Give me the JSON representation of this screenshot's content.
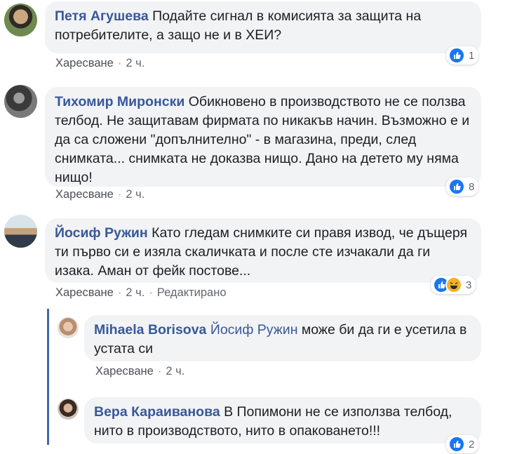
{
  "comments": [
    {
      "author": "Петя Агушева",
      "text": "Подайте сигнал в комисията за защита на",
      "text2": "потребителите, а защо не и в ХЕИ?",
      "like_label": "Харесване",
      "time": "2 ч.",
      "reaction_count": "1"
    },
    {
      "author": "Тихомир Миронски",
      "text": "Обикновено в производството не се ползва",
      "text2": "телбод. Не защитавам фирмата по никакъв начин. Възможно е и",
      "text3": "да са сложени \"допълнително\" - в магазина, преди, след",
      "text4": "снимката... снимката не доказва нищо. Дано на детето му няма",
      "text5": "нищо!",
      "like_label": "Харесване",
      "time": "2 ч.",
      "reaction_count": "8"
    },
    {
      "author": "Йосиф Ружин",
      "text": "Като гледам снимките си правя извод, че дъщеря",
      "text2": "ти първо си е изяла скаличката и после сте изчакали да ги",
      "text3": "изака. Аман от фейк постове...",
      "like_label": "Харесване",
      "time": "2 ч.",
      "edited_label": "Редактирано",
      "reaction_count": "3"
    }
  ],
  "replies": [
    {
      "author": "Mihaela Borisova",
      "mention": "Йосиф Ружин",
      "text": "може би да ги е усетила в",
      "text2": "устата си",
      "like_label": "Харесване",
      "time": "2 ч."
    },
    {
      "author": "Вера Караиванова",
      "text": "В Попимони не се използва телбод,",
      "text2": "нито в производството, нито в опаковането!!!",
      "reaction_count": "2"
    }
  ],
  "icons": {
    "like": "like-reaction-icon",
    "haha": "haha-reaction-icon"
  },
  "colors": {
    "author_link": "#385898",
    "bubble_bg": "#f2f3f5",
    "like_blue": "#1877f2",
    "thread_line": "#4267b2"
  }
}
